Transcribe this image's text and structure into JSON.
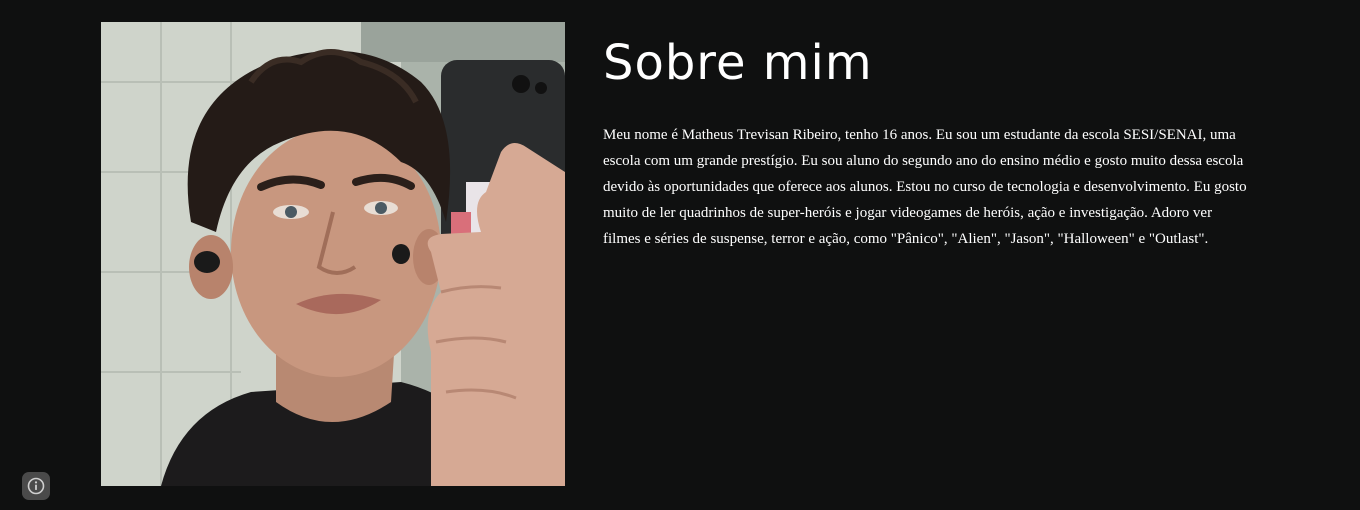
{
  "about": {
    "title": "Sobre mim",
    "bio": "Meu nome é Matheus Trevisan Ribeiro, tenho 16 anos. Eu sou um estudante da escola SESI/SENAI, uma escola com um grande prestígio. Eu sou aluno do segundo ano do ensino médio e gosto muito dessa escola devido às oportunidades que oferece aos alunos. Estou no curso de tecnologia e desenvolvimento. Eu gosto muito de ler quadrinhos de super-heróis e jogar videogames de heróis, ação e investigação. Adoro ver filmes e séries de suspense, terror e ação, como \"Pânico\", \"Alien\", \"Jason\", \"Halloween\" e \"Outlast\"."
  },
  "photo": {
    "subject": "mirror selfie of a young man with curly dark hair holding a phone"
  },
  "info_button": {
    "icon": "info-icon"
  },
  "colors": {
    "background": "#0f1010",
    "text": "#ffffff",
    "info_button_bg": "#4a4a4a"
  }
}
